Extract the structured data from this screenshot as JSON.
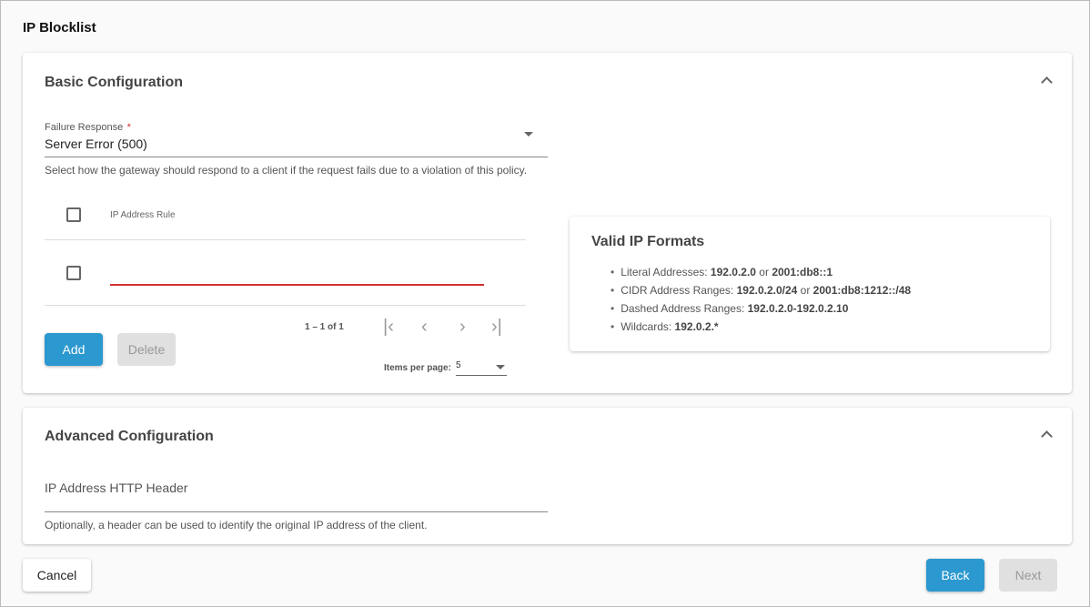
{
  "page_title": "IP Blocklist",
  "basic": {
    "title": "Basic Configuration",
    "failure_label": "Failure Response",
    "required_mark": "*",
    "failure_value": "Server Error (500)",
    "failure_hint": "Select how the gateway should respond to a client if the request fails due to a violation of this policy.",
    "table_header": "IP Address Rule",
    "add": "Add",
    "delete": "Delete",
    "range": "1 – 1 of 1",
    "items_per_page_label": "Items per page:",
    "items_per_page": "5"
  },
  "formats": {
    "title": "Valid IP Formats",
    "items": [
      {
        "label": "Literal Addresses: ",
        "v1": "192.0.2.0",
        "or": " or ",
        "v2": "2001:db8::1"
      },
      {
        "label": "CIDR Address Ranges: ",
        "v1": "192.0.2.0/24",
        "or": " or ",
        "v2": "2001:db8:1212::/48"
      },
      {
        "label": "Dashed Address Ranges: ",
        "v1": "192.0.2.0-192.0.2.10"
      },
      {
        "label": "Wildcards: ",
        "v1": "192.0.2.*"
      }
    ]
  },
  "advanced": {
    "title": "Advanced Configuration",
    "header_placeholder": "IP Address HTTP Header",
    "header_hint": "Optionally, a header can be used to identify the original IP address of the client."
  },
  "footer": {
    "cancel": "Cancel",
    "back": "Back",
    "next": "Next"
  },
  "colors": {
    "primary": "#2b98d0",
    "error": "#d32f2f",
    "disabled": "#e0e0e0"
  }
}
